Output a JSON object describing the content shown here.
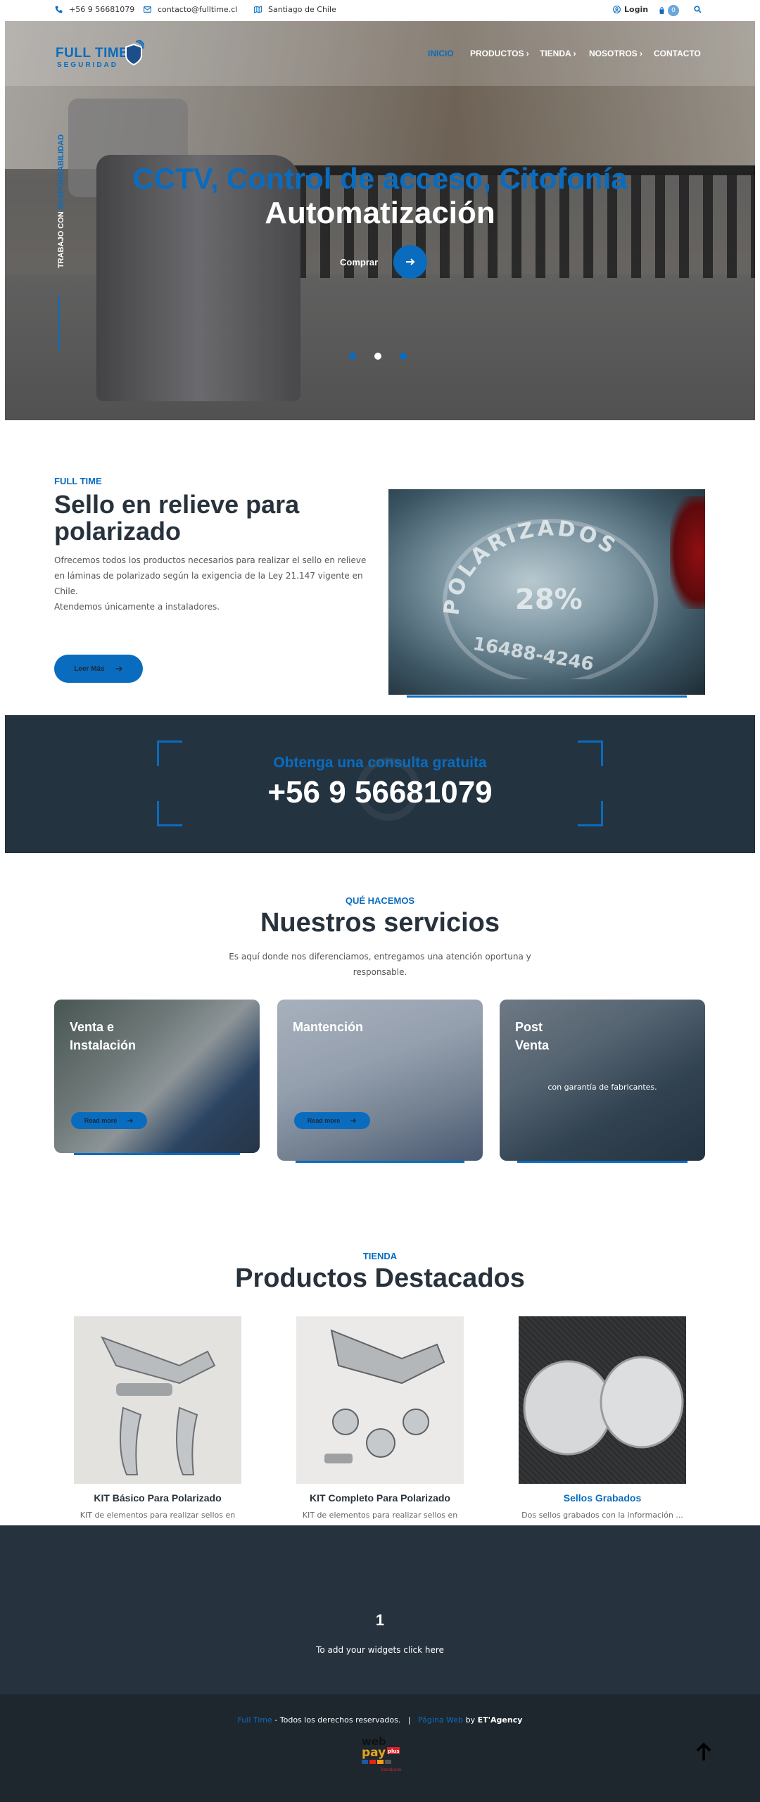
{
  "topbar": {
    "phone": "+56 9 56681079",
    "email": "contacto@fulltime.cl",
    "location": "Santiago de Chile",
    "login": "Login",
    "cart_count": "0"
  },
  "logo": {
    "line1": "FULL TIME",
    "line2": "SEGURIDAD"
  },
  "nav": {
    "inicio": "INICIO",
    "productos": "PRODUCTOS",
    "tienda": "TIENDA",
    "nosotros": "NOSOTROS",
    "contacto": "CONTACTO"
  },
  "hero": {
    "vertical_a": "TRABAJO CON ",
    "vertical_b": "RESPONSABILIDAD",
    "title1": "CCTV, Control de acceso, Citofonía",
    "title2": "Automatización",
    "cta": "Comprar",
    "slides": 3,
    "active_slide": 2
  },
  "about": {
    "kicker": "FULL TIME",
    "title": "Sello en relieve para polarizado",
    "p1": "Ofrecemos todos los productos necesarios para realizar el sello en relieve en láminas de polarizado según la exigencia de la Ley 21.147 vigente en Chile.",
    "p2": "Atendemos únicamente a instaladores.",
    "button": "Leer Más",
    "image_text": {
      "arc": "POLARIZADOS",
      "percent": "28%",
      "code": "16488-4246"
    }
  },
  "consult": {
    "kicker": "Obtenga una consulta gratuita",
    "phone": "+56 9 56681079"
  },
  "services": {
    "kicker": "QUÉ HACEMOS",
    "title": "Nuestros servicios",
    "desc": "Es aquí donde nos diferenciamos, entregamos una atención oportuna y responsable.",
    "cards": [
      {
        "title": "Venta e Instalación",
        "read_more": "Read more"
      },
      {
        "title": "Mantención",
        "read_more": "Read more"
      },
      {
        "title": "Post Venta",
        "sub": "con garantía de fabricantes."
      }
    ]
  },
  "products": {
    "kicker": "TIENDA",
    "title": "Productos Destacados",
    "items": [
      {
        "name": "KIT Básico Para Polarizado",
        "desc": "KIT de elementos para realizar sellos en"
      },
      {
        "name": "KIT Completo Para Polarizado",
        "desc": "KIT de elementos para realizar sellos en"
      },
      {
        "name": "Sellos Grabados",
        "desc": "Dos sellos grabados con la información ..."
      }
    ]
  },
  "widget": {
    "number": "1",
    "text": "To add your widgets click here"
  },
  "footer": {
    "brand": "Full Time",
    "rights": " - Todos los derechos reservados.",
    "sep": "|",
    "web": "Página Web",
    "by": " by ",
    "agency": "ET'Agency",
    "webpay_a": "web",
    "webpay_b": "pay",
    "webpay_plus": "plus",
    "webpay_tag": "Transbank"
  },
  "colors": {
    "accent": "#0a6cbf",
    "dark": "#243340",
    "footer": "#1e272e"
  }
}
